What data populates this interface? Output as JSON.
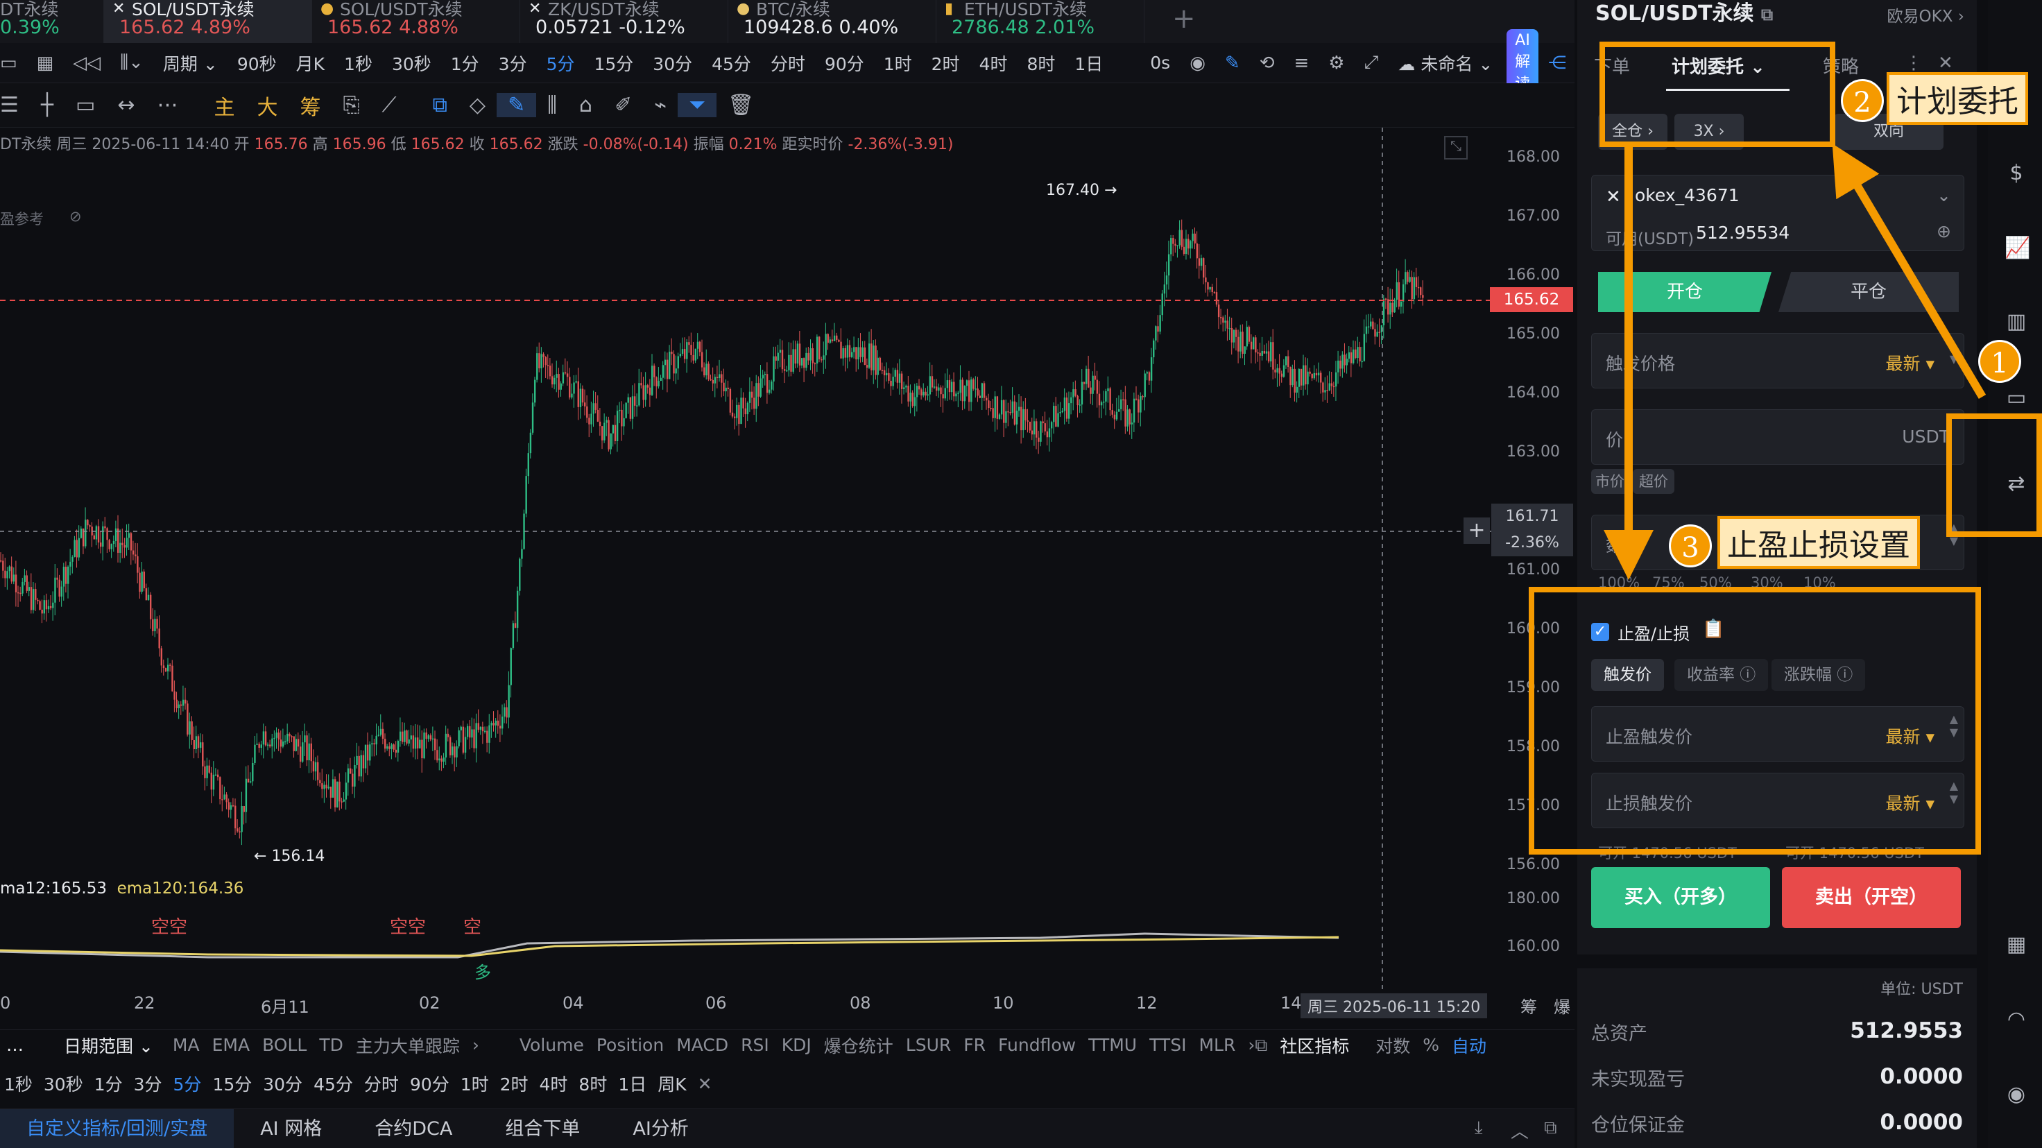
{
  "top_tabs": [
    {
      "name": "DT永续",
      "price": "",
      "change": "0.39%",
      "color": "dn"
    },
    {
      "name": "SOL/USDT永续",
      "price": "165.62",
      "change": "4.89%",
      "color": "up"
    },
    {
      "name": "SOL/USDT永续",
      "price": "165.62",
      "change": "4.88%",
      "color": "up"
    },
    {
      "name": "ZK/USDT永续",
      "price": "0.05721",
      "change": "-0.12%",
      "color": "wh"
    },
    {
      "name": "BTC/永续",
      "price": "109428.6",
      "change": "0.40%",
      "color": "wh"
    },
    {
      "name": "ETH/USDT永续",
      "price": "2786.48",
      "change": "2.01%",
      "color": "dn"
    }
  ],
  "toolbar1": {
    "periods_label": "周期",
    "items": [
      "90秒",
      "月K",
      "1秒",
      "30秒",
      "1分",
      "3分",
      "5分",
      "15分",
      "30分",
      "45分",
      "分时",
      "90分",
      "1时",
      "2时",
      "4时",
      "8时",
      "1日"
    ],
    "selected": "5分",
    "countdown": "0s",
    "layout_name": "未命名",
    "ai_label": "AI解读"
  },
  "toolbar2": {
    "main_label": "主",
    "big_label": "大",
    "chip_label": "筹"
  },
  "info_line": {
    "symbol": "DT永续",
    "datetime": "周三 2025-06-11 14:40",
    "open_label": "开",
    "open": "165.76",
    "high_label": "高",
    "high": "165.96",
    "low_label": "低",
    "low": "165.62",
    "close_label": "收",
    "close": "165.62",
    "chg_label": "涨跌",
    "chg": "-0.08%(-0.14)",
    "amp_label": "振幅",
    "amp": "0.21%",
    "dist_label": "距实时价",
    "dist": "-2.36%(-3.91)"
  },
  "side_legend": [
    "盈参考"
  ],
  "price_axis": [
    "168.00",
    "167.00",
    "166.00",
    "165.00",
    "164.00",
    "163.00",
    "161.00",
    "160.00",
    "159.00",
    "158.00",
    "157.00",
    "156.00"
  ],
  "current_price": "165.62",
  "crosshair_price": "161.71",
  "crosshair_pct": "-2.36%",
  "high_mark": "167.40",
  "low_mark": "156.14",
  "ema_line": {
    "a": "ma12:165.53",
    "b": "ema120:164.36"
  },
  "signals": [
    "空",
    "空",
    "空空",
    "空",
    "多"
  ],
  "sub_axis": [
    "180.00",
    "160.00"
  ],
  "x_axis": [
    "0",
    "22",
    "6月11",
    "02",
    "04",
    "06",
    "08",
    "10",
    "12",
    "14"
  ],
  "crosshair_time": "周三 2025-06-11 15:20",
  "x_right": [
    "筹",
    "爆"
  ],
  "ind_bar": {
    "date_range": "日期范围",
    "left": [
      "MA",
      "EMA",
      "BOLL",
      "TD",
      "主力大单跟踪"
    ],
    "right": [
      "Volume",
      "Position",
      "MACD",
      "RSI",
      "KDJ",
      "爆仓统计",
      "LSUR",
      "FR",
      "Fundflow",
      "TTMU",
      "TTSI",
      "MLR"
    ],
    "community": "社区指标",
    "log": "对数",
    "pct": "%",
    "auto": "自动"
  },
  "period_bar": {
    "items": [
      "1秒",
      "30秒",
      "1分",
      "3分",
      "5分",
      "15分",
      "30分",
      "45分",
      "分时",
      "90分",
      "1时",
      "2时",
      "4时",
      "8时",
      "1日",
      "周K"
    ],
    "selected": "5分"
  },
  "bottom_tabs": [
    "自定义指标/回测/实盘",
    "AI 网格",
    "合约DCA",
    "组合下单",
    "AI分析"
  ],
  "panel": {
    "symbol": "SOL/USDT永续",
    "exchange": "欧易OKX",
    "tabs": [
      "下单",
      "计划委托",
      "策略"
    ],
    "margin_mode": "全仓",
    "leverage": "3X",
    "position_mode": "双向",
    "account": "okex_43671",
    "avail_label": "可用(USDT)",
    "avail_value": "512.95534",
    "open_label": "开仓",
    "close_label": "平仓",
    "trigger_price_label": "触发价格",
    "latest": "最新",
    "price_label": "价",
    "unit": "USDT",
    "market_label": "市价",
    "super_label": "超价",
    "qty_label": "数",
    "pct_options": [
      "100%",
      "75%",
      "50%",
      "30%",
      "10%"
    ],
    "tpsl_label": "止盈/止损",
    "tpsl_modes": [
      "触发价",
      "收益率",
      "涨跌幅"
    ],
    "tp_label": "止盈触发价",
    "sl_label": "止损触发价",
    "max_left": "可开 1470.56 USDT",
    "max_right": "可开 1470.56 USDT",
    "buy_label": "买入（开多）",
    "sell_label": "卖出（开空）",
    "unit_label": "单位: USDT",
    "assets": [
      {
        "k": "总资产",
        "v": "512.9553"
      },
      {
        "k": "未实现盈亏",
        "v": "0.0000"
      },
      {
        "k": "仓位保证金",
        "v": "0.0000"
      }
    ]
  },
  "annotations": [
    {
      "num": "1",
      "label": ""
    },
    {
      "num": "2",
      "label": "计划委托"
    },
    {
      "num": "3",
      "label": "止盈止损设置"
    }
  ],
  "colors": {
    "up": "#e15656",
    "down": "#2ebd85",
    "accent": "#3a8df5",
    "annotation": "#f59a00"
  }
}
